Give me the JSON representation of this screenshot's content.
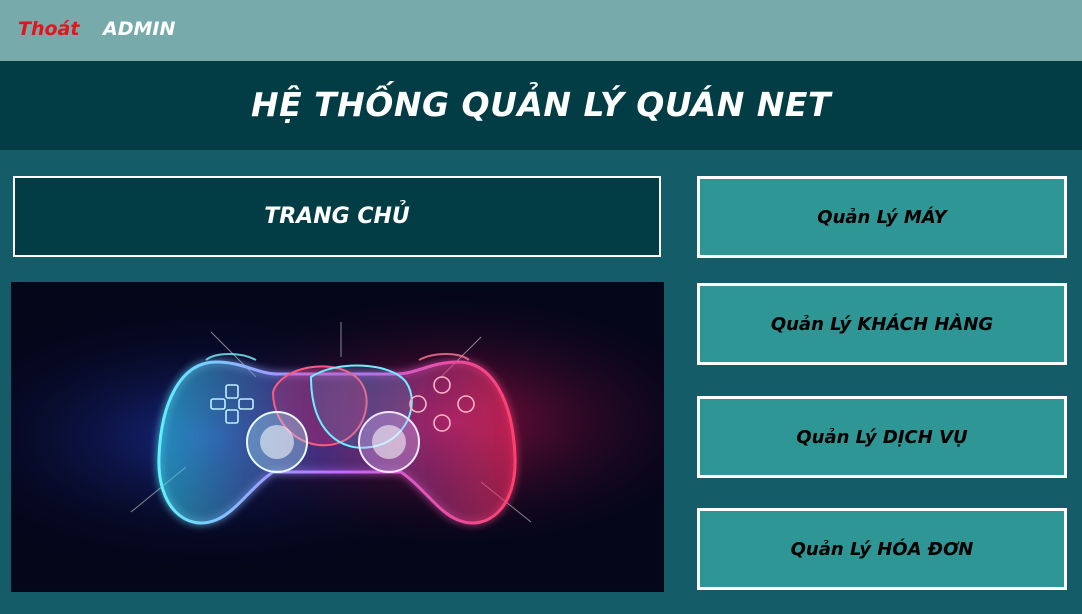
{
  "topbar": {
    "exit_label": "Thoát",
    "user_label": "ADMIN"
  },
  "header": {
    "title": "HỆ THỐNG QUẢN LÝ QUÁN NET"
  },
  "home_button": {
    "label": "TRANG CHỦ"
  },
  "menu": [
    {
      "label": "Quản Lý MÁY"
    },
    {
      "label": "Quản Lý KHÁCH HÀNG"
    },
    {
      "label": "Quản Lý DỊCH VỤ"
    },
    {
      "label": "Quản Lý HÓA ĐƠN"
    }
  ],
  "banner": {
    "icon": "gamepad-icon"
  },
  "colors": {
    "topbar_bg": "#76aaab",
    "title_bg": "#023c44",
    "page_bg": "#145c68",
    "menu_bg": "#2e9694",
    "exit_color": "#e3141b",
    "glow_blue": "#29d4f0",
    "glow_red": "#ff2a5c"
  }
}
